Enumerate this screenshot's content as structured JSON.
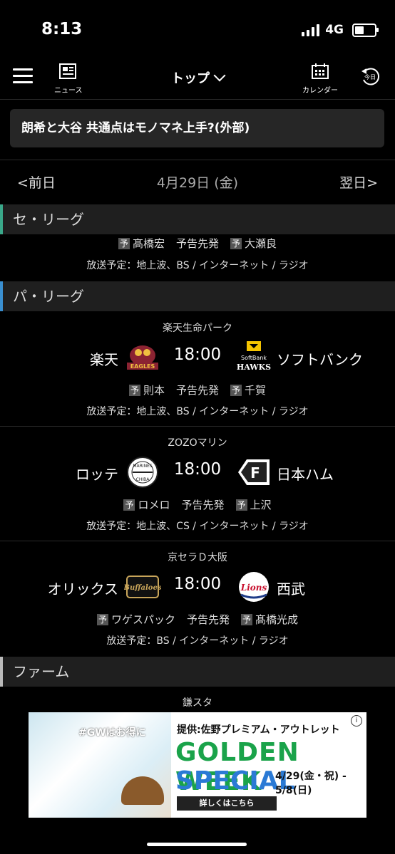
{
  "status": {
    "time": "8:13",
    "network": "4G"
  },
  "nav": {
    "menu_icon": "hamburger-icon",
    "news_label": "ニュース",
    "title": "トップ",
    "calendar_label": "カレンダー",
    "today_label": "今日"
  },
  "headline": "朗希と大谷 共通点はモノマネ上手?(外部)",
  "datebar": {
    "prev": "前日",
    "date": "4月29日 (金)",
    "next": "翌日"
  },
  "leagues": {
    "central": "セ・リーグ",
    "pacific": "パ・リーグ",
    "farm": "ファーム"
  },
  "prefix_label": "予",
  "central_game": {
    "home_pitcher": "髙橋宏",
    "status": "予告先発",
    "away_pitcher": "大瀬良",
    "broadcast": "放送予定：地上波、BS / インターネット / ラジオ"
  },
  "pacific_games": [
    {
      "venue": "楽天生命パーク",
      "home": "楽天",
      "time": "18:00",
      "away": "ソフトバンク",
      "home_pitcher": "則本",
      "status": "予告先発",
      "away_pitcher": "千賀",
      "broadcast": "放送予定：地上波、BS / インターネット / ラジオ",
      "home_logo": "eagles-logo",
      "away_logo": "hawks-logo"
    },
    {
      "venue": "ZOZOマリン",
      "home": "ロッテ",
      "time": "18:00",
      "away": "日本ハム",
      "home_pitcher": "ロメロ",
      "status": "予告先発",
      "away_pitcher": "上沢",
      "broadcast": "放送予定：地上波、CS / インターネット / ラジオ",
      "home_logo": "marines-logo",
      "away_logo": "fighters-logo"
    },
    {
      "venue": "京セラＤ大阪",
      "home": "オリックス",
      "time": "18:00",
      "away": "西武",
      "home_pitcher": "ワゲスパック",
      "status": "予告先発",
      "away_pitcher": "髙橋光成",
      "broadcast": "放送予定：BS / インターネット / ラジオ",
      "home_logo": "buffaloes-logo",
      "away_logo": "lions-logo"
    }
  ],
  "farm_venue": "鎌スタ",
  "ad": {
    "tag": "#GWはお得に",
    "sponsor": "提供:佐野プレミアム・アウトレット",
    "line1": "GOLDEN WEEK",
    "line2": "SPECIAL",
    "dates_1": "4/29(金・祝) -",
    "dates_2": "5/8(日)",
    "cta": "詳しくはこちら",
    "info": "i"
  },
  "colors": {
    "central_accent": "#3aa88a",
    "pacific_accent": "#3a8fd0",
    "ad_green": "#1aa34a",
    "ad_blue": "#2a7ad5"
  }
}
